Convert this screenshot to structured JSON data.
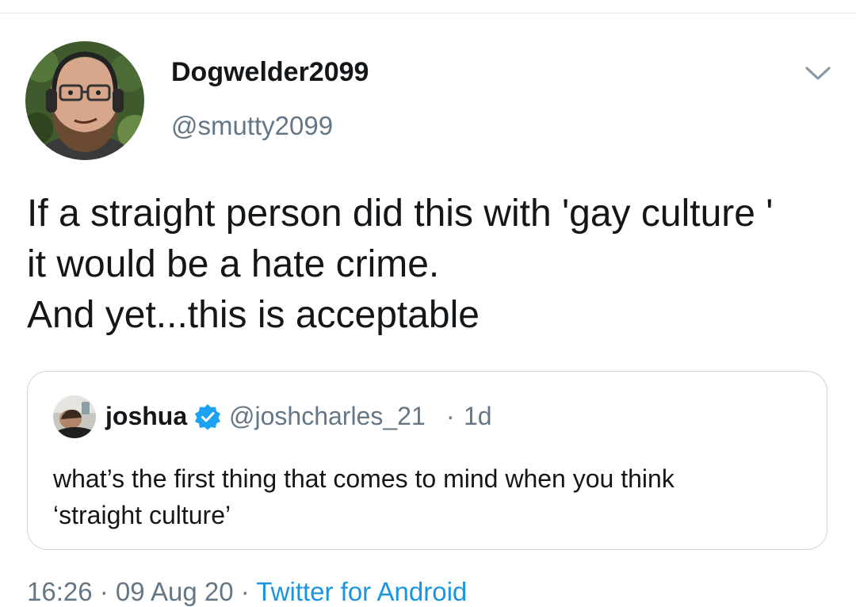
{
  "author": {
    "display_name": "Dogwelder2099",
    "handle": "@smutty2099",
    "avatar_icon": "profile-photo"
  },
  "menu": {
    "icon": "chevron-down-icon"
  },
  "tweet": {
    "lines": [
      "If a straight person did this with 'gay culture '",
      "it would be a hate crime.",
      "And yet...this is acceptable"
    ]
  },
  "quoted_tweet": {
    "display_name": "joshua",
    "verified": true,
    "verified_icon": "verified-badge-icon",
    "handle": "@joshcharles_21",
    "separator": "·",
    "time": "1d",
    "lines": [
      "what’s the first thing that comes to mind when you think",
      "‘straight culture’"
    ]
  },
  "meta": {
    "time": "16:26",
    "sep1": " · ",
    "date": "09 Aug 20",
    "sep2": " · ",
    "source": "Twitter for Android"
  },
  "colors": {
    "text": "#14171a",
    "secondary": "#657786",
    "link": "#1b95e0",
    "verified": "#1da1f2",
    "border": "#ccd6dd"
  }
}
